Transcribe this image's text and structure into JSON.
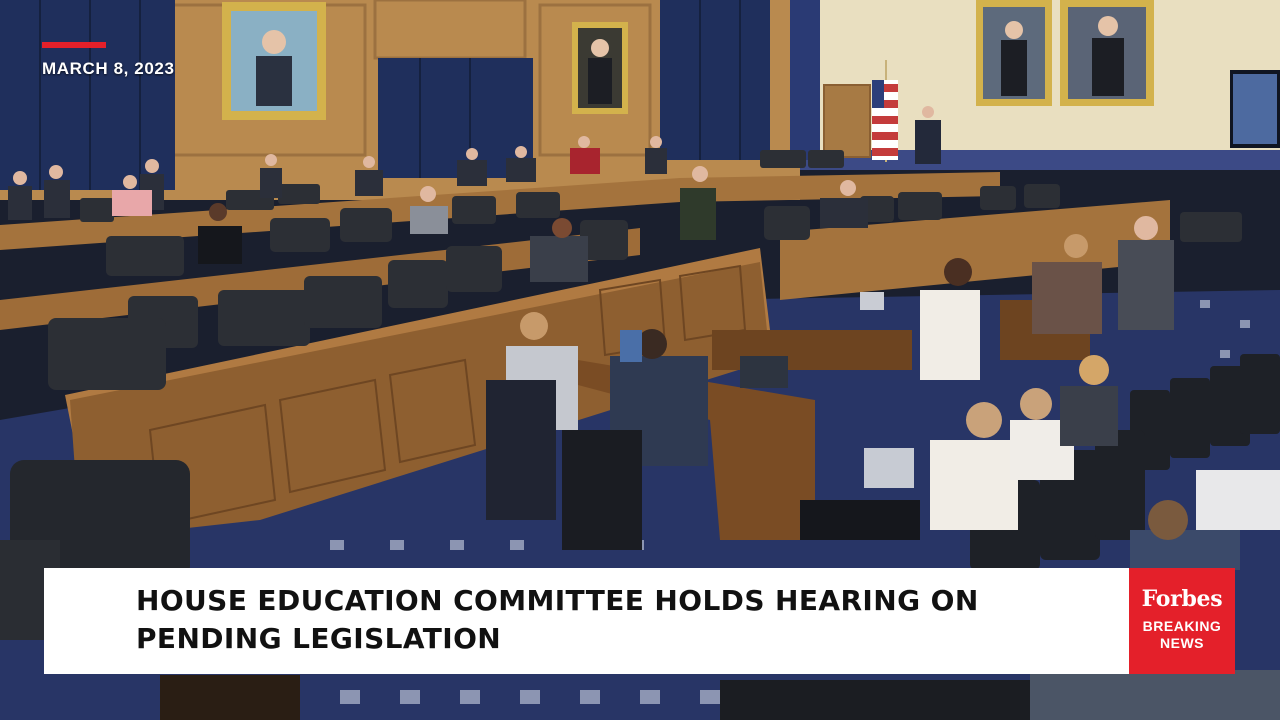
{
  "overlay": {
    "date": "MARCH 8, 2023",
    "headline_line1": "HOUSE EDUCATION COMMITTEE HOLDS HEARING ON",
    "headline_line2": "PENDING LEGISLATION"
  },
  "brand": {
    "name": "Forbes",
    "tag_line1": "BREAKING",
    "tag_line2": "NEWS"
  },
  "colors": {
    "accent_red": "#e4202a",
    "banner_bg": "#ffffff",
    "headline_text": "#111111",
    "curtain_blue": "#1f2f5c",
    "wood_paneling": "#b98a4f",
    "carpet_blue": "#283566"
  }
}
